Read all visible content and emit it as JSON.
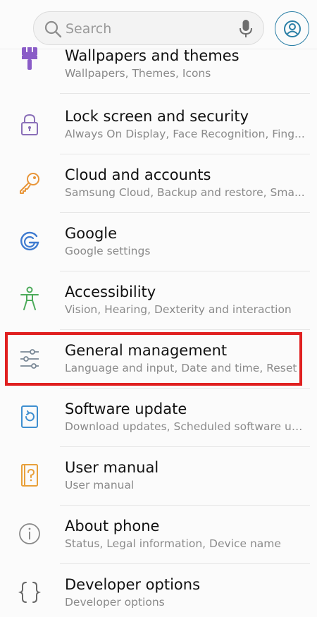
{
  "search": {
    "placeholder": "Search"
  },
  "icons": {
    "search": "search-icon",
    "mic": "microphone-icon",
    "profile": "account-icon"
  },
  "colors": {
    "accent": "#2a7fa6",
    "highlight": "#e02020"
  },
  "settings": {
    "items": [
      {
        "title": "Wallpapers and themes",
        "subtitle": "Wallpapers, Themes, Icons",
        "icon": "paintbrush-icon",
        "icon_color": "#8a5cc7"
      },
      {
        "title": "Lock screen and security",
        "subtitle": "Always On Display, Face Recognition, Fing...",
        "icon": "lock-icon",
        "icon_color": "#8a6fb8"
      },
      {
        "title": "Cloud and accounts",
        "subtitle": "Samsung Cloud, Backup and restore, Sma...",
        "icon": "key-icon",
        "icon_color": "#e8963a"
      },
      {
        "title": "Google",
        "subtitle": "Google settings",
        "icon": "google-icon",
        "icon_color": "#3f7bd0"
      },
      {
        "title": "Accessibility",
        "subtitle": "Vision, Hearing, Dexterity and interaction",
        "icon": "accessibility-icon",
        "icon_color": "#4caa5a"
      },
      {
        "title": "General management",
        "subtitle": "Language and input, Date and time, Reset",
        "icon": "sliders-icon",
        "icon_color": "#7a8896"
      },
      {
        "title": "Software update",
        "subtitle": "Download updates, Scheduled software up...",
        "icon": "software-update-icon",
        "icon_color": "#3f8fd0"
      },
      {
        "title": "User manual",
        "subtitle": "User manual",
        "icon": "user-manual-icon",
        "icon_color": "#e8a03a"
      },
      {
        "title": "About phone",
        "subtitle": "Status, Legal information, Device name",
        "icon": "info-icon",
        "icon_color": "#8a8a8a"
      },
      {
        "title": "Developer options",
        "subtitle": "Developer options",
        "icon": "braces-icon",
        "icon_color": "#666666"
      }
    ]
  }
}
